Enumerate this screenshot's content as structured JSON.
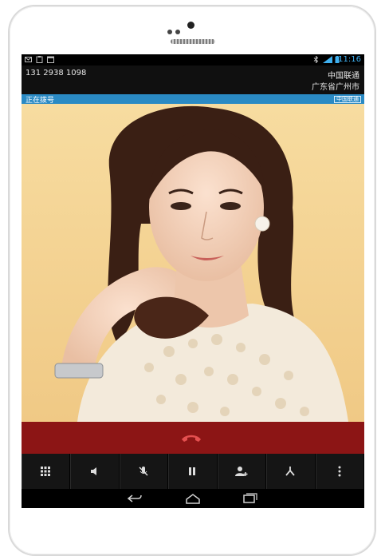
{
  "status_bar": {
    "time": "11:16"
  },
  "call": {
    "phone_number": "131 2938 1098",
    "carrier": "中国联通",
    "region": "广东省广州市",
    "state": "正在拨号",
    "operator_badge": "中国联通"
  },
  "call_actions": [
    {
      "name": "dialpad",
      "icon": "dialpad-icon"
    },
    {
      "name": "speaker",
      "icon": "speaker-icon"
    },
    {
      "name": "mute",
      "icon": "mic-off-icon"
    },
    {
      "name": "hold",
      "icon": "pause-icon"
    },
    {
      "name": "add-call",
      "icon": "add-contact-icon"
    },
    {
      "name": "merge",
      "icon": "merge-icon"
    },
    {
      "name": "more",
      "icon": "more-vert-icon"
    }
  ],
  "colors": {
    "end_call_bar": "#8c1515",
    "accent_blue": "#2a8ac4",
    "end_call_icon": "#e55050"
  }
}
